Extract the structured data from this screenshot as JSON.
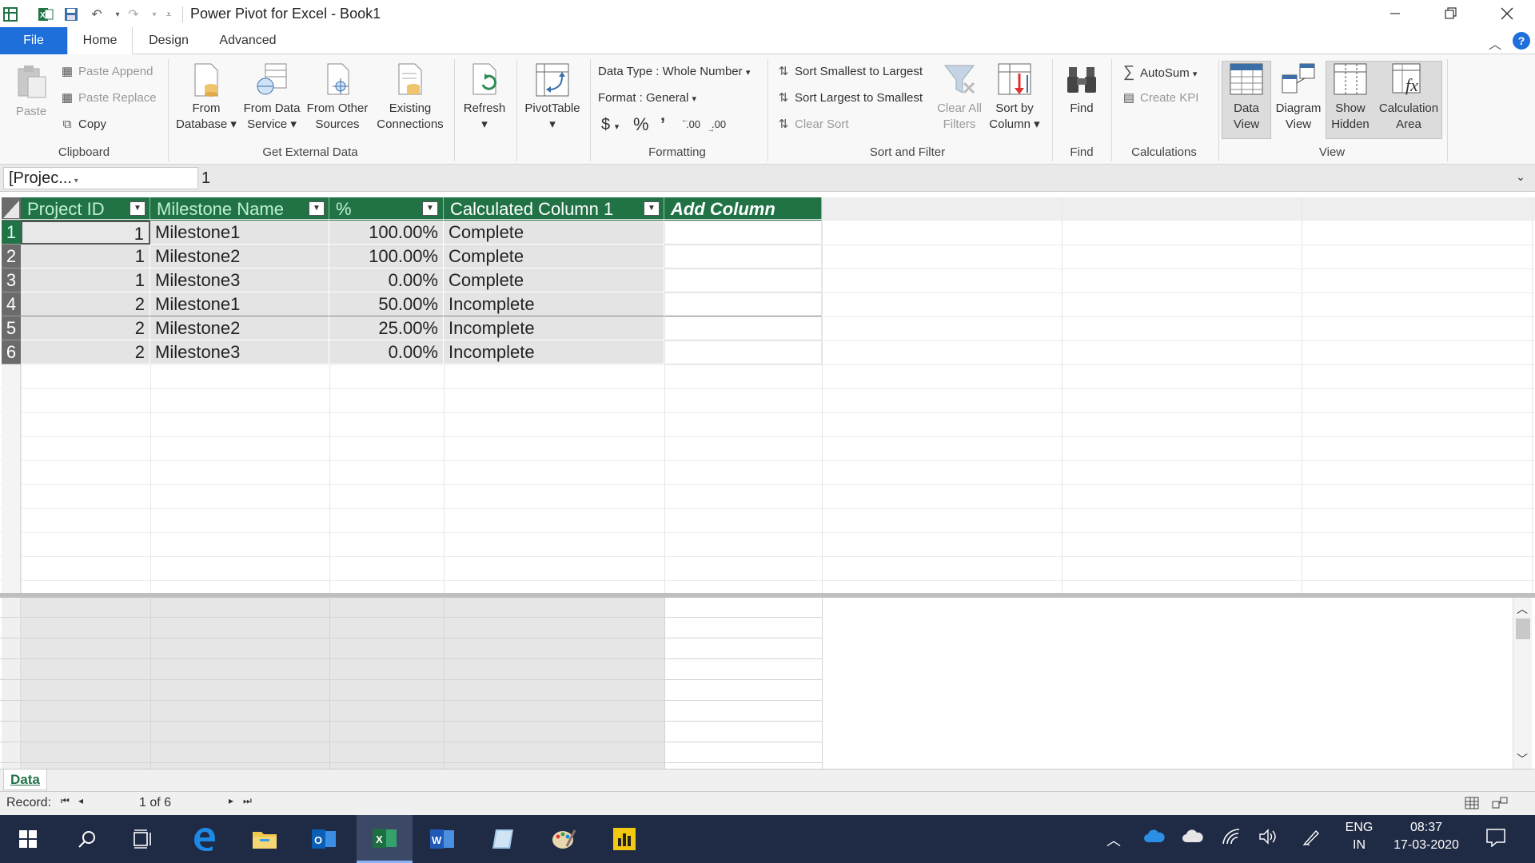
{
  "window": {
    "title": "Power Pivot for Excel - Book1"
  },
  "tabs": [
    "File",
    "Home",
    "Design",
    "Advanced"
  ],
  "ribbon": {
    "clipboard": {
      "paste": "Paste",
      "paste_append": "Paste Append",
      "paste_replace": "Paste Replace",
      "copy": "Copy",
      "label": "Clipboard"
    },
    "external": {
      "from_database_1": "From",
      "from_database_2": "Database",
      "from_service_1": "From Data",
      "from_service_2": "Service",
      "from_other_1": "From Other",
      "from_other_2": "Sources",
      "existing_1": "Existing",
      "existing_2": "Connections",
      "label": "Get External Data"
    },
    "refresh": "Refresh",
    "pivottable": "PivotTable",
    "formatting": {
      "data_type": "Data Type : Whole Number",
      "format": "Format : General",
      "currency": "$",
      "percent": "%",
      "comma": "’",
      "label": "Formatting"
    },
    "sort": {
      "sort_asc": "Sort Smallest to Largest",
      "sort_desc": "Sort Largest to Smallest",
      "clear_sort": "Clear Sort",
      "clear_filters_1": "Clear All",
      "clear_filters_2": "Filters",
      "sort_by_1": "Sort by",
      "sort_by_2": "Column",
      "label": "Sort and Filter"
    },
    "find": {
      "find": "Find",
      "label": "Find"
    },
    "calculations": {
      "autosum": "AutoSum",
      "create_kpi": "Create KPI",
      "label": "Calculations"
    },
    "view": {
      "data_view_1": "Data",
      "data_view_2": "View",
      "diagram_view_1": "Diagram",
      "diagram_view_2": "View",
      "show_hidden_1": "Show",
      "show_hidden_2": "Hidden",
      "calc_area_1": "Calculation",
      "calc_area_2": "Area",
      "label": "View"
    }
  },
  "formula_bar": {
    "name_box": "[Projec...",
    "value": "1"
  },
  "table": {
    "columns": [
      "Project ID",
      "Milestone Name",
      "%",
      "Calculated Column 1",
      "Add Column"
    ],
    "rows": [
      {
        "n": "1",
        "id": "1",
        "name": "Milestone1",
        "pct": "100.00%",
        "calc": "Complete"
      },
      {
        "n": "2",
        "id": "1",
        "name": "Milestone2",
        "pct": "100.00%",
        "calc": "Complete"
      },
      {
        "n": "3",
        "id": "1",
        "name": "Milestone3",
        "pct": "0.00%",
        "calc": "Complete"
      },
      {
        "n": "4",
        "id": "2",
        "name": "Milestone1",
        "pct": "50.00%",
        "calc": "Incomplete"
      },
      {
        "n": "5",
        "id": "2",
        "name": "Milestone2",
        "pct": "25.00%",
        "calc": "Incomplete"
      },
      {
        "n": "6",
        "id": "2",
        "name": "Milestone3",
        "pct": "0.00%",
        "calc": "Incomplete"
      }
    ]
  },
  "sheet_tab": "Data",
  "status": {
    "record_label": "Record:",
    "record_pos": "1 of 6"
  },
  "taskbar": {
    "lang_1": "ENG",
    "lang_2": "IN",
    "time": "08:37",
    "date": "17-03-2020"
  },
  "colors": {
    "header_green": "#217346",
    "file_tab_blue": "#1e6fd9",
    "taskbar": "#1f2a44"
  }
}
